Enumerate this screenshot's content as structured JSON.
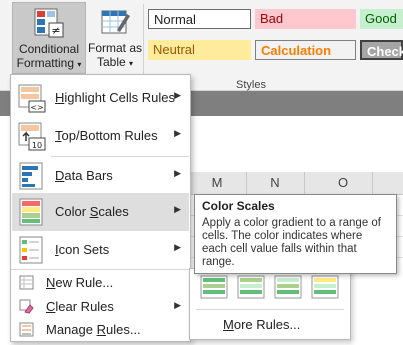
{
  "ribbon": {
    "conditional_formatting": {
      "line1": "Conditional",
      "line2": "Formatting"
    },
    "format_as_table": {
      "line1": "Format as",
      "line2": "Table"
    },
    "styles_group_label": "Styles",
    "cell_styles": [
      {
        "label": "Normal"
      },
      {
        "label": "Bad"
      },
      {
        "label": "Good"
      },
      {
        "label": "Neutral"
      },
      {
        "label": "Calculation"
      },
      {
        "label": "Check"
      }
    ]
  },
  "sheet": {
    "columns": [
      "M",
      "N",
      "O"
    ]
  },
  "menu": {
    "items": [
      {
        "pre": "",
        "key": "H",
        "post": "ighlight Cells Rules",
        "submenu": true
      },
      {
        "pre": "",
        "key": "T",
        "post": "op/Bottom Rules",
        "submenu": true
      },
      {
        "pre": "",
        "key": "D",
        "post": "ata Bars",
        "submenu": true
      },
      {
        "pre": "Color ",
        "key": "S",
        "post": "cales",
        "submenu": true,
        "highlighted": true
      },
      {
        "pre": "",
        "key": "I",
        "post": "con Sets",
        "submenu": true
      }
    ],
    "small_items": [
      {
        "pre": "",
        "key": "N",
        "post": "ew Rule..."
      },
      {
        "pre": "",
        "key": "C",
        "post": "lear Rules",
        "submenu": true
      },
      {
        "pre": "Manage ",
        "key": "R",
        "post": "ules..."
      }
    ]
  },
  "submenu": {
    "more_rules_pre": "",
    "more_rules_key": "M",
    "more_rules_post": "ore Rules..."
  },
  "tooltip": {
    "title": "Color Scales",
    "body": "Apply a color gradient to a range of cells. The color indicates where each cell value falls within that range."
  },
  "colors": {
    "menu_highlight": "#dedede",
    "ribbon_bg": "#f3f3f3",
    "selected_button": "#c9c9c9"
  }
}
